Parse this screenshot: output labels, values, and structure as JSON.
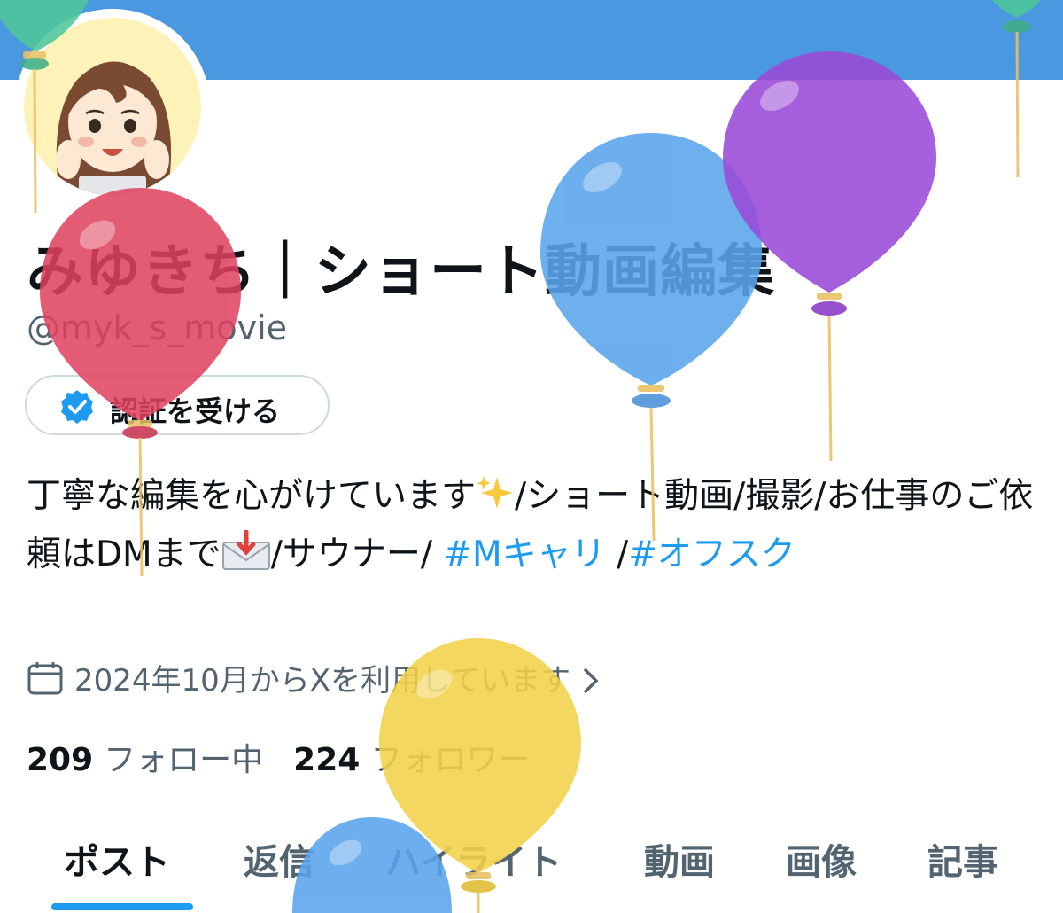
{
  "profile": {
    "display_name": "みゆきち｜ショート動画編集",
    "handle": "@myk_s_movie",
    "verify_button_label": "認証を受ける",
    "bio": {
      "text1": "丁寧な編集を心がけています",
      "text2": "/ショート動画/撮影/お仕事のご依頼はDMまで",
      "text3": "/サウナー/ ",
      "hashtag1": "#Mキャリ",
      "sep": " /",
      "hashtag2": "#オフスク"
    },
    "joined_text": "2024年10月からXを利用しています",
    "following_count": "209",
    "following_label": "フォロー中",
    "followers_count": "224",
    "followers_label": "フォロワー"
  },
  "tabs": [
    {
      "label": "ポスト",
      "active": true
    },
    {
      "label": "返信",
      "active": false
    },
    {
      "label": "ハイライト",
      "active": false
    },
    {
      "label": "動画",
      "active": false
    },
    {
      "label": "画像",
      "active": false
    },
    {
      "label": "記事",
      "active": false
    }
  ],
  "icons": {
    "verify": "verified-badge-icon",
    "calendar": "calendar-icon",
    "chevron": "chevron-right-icon",
    "sparkles": "sparkles-emoji",
    "envelope": "incoming-envelope-emoji"
  },
  "colors": {
    "banner": "#4a98e0",
    "link": "#1d9bf0",
    "secondary_text": "#536471",
    "balloon_red": "#e0415e",
    "balloon_blue": "#5aa4ec",
    "balloon_purple": "#9a4ad8",
    "balloon_yellow": "#f2d24a",
    "balloon_green": "#4fc79a"
  }
}
